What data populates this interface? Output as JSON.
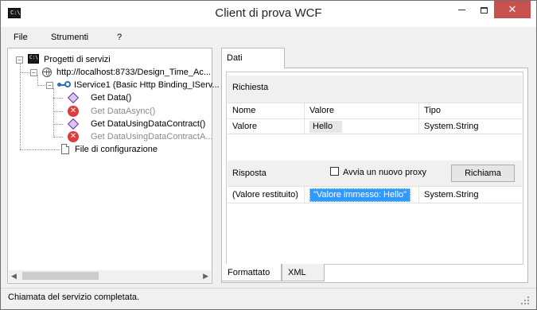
{
  "window": {
    "title": "Client di prova WCF",
    "app_icon": "console-icon",
    "min_glyph": "",
    "max_glyph": "",
    "close_glyph": "✕"
  },
  "menu": {
    "items": [
      "File",
      "Strumenti",
      "?"
    ]
  },
  "tree": {
    "root": "Progetti di servizi",
    "endpoint": "http://localhost:8733/Design_Time_Ac...",
    "contract": "IService1 (Basic Http Binding_IServ...",
    "ops": [
      {
        "label": "Get Data()",
        "state": "ok"
      },
      {
        "label": "Get DataAsync()",
        "state": "error"
      },
      {
        "label": "Get DataUsingDataContract()",
        "state": "ok"
      },
      {
        "label": "Get DataUsingDataContractA...",
        "state": "error"
      }
    ],
    "config": "File di configurazione",
    "expanded_glyph": "−"
  },
  "tabs": {
    "top": "Dati",
    "bottom": [
      "Formattato",
      "XML"
    ]
  },
  "request": {
    "title": "Richiesta",
    "columns": [
      "Nome",
      "Valore",
      "Tipo"
    ],
    "rows": [
      {
        "name": "Valore",
        "value": "Hello",
        "type": "System.String"
      }
    ]
  },
  "response": {
    "title": "Risposta",
    "new_proxy_label": "Avvia un nuovo proxy",
    "new_proxy_checked": false,
    "invoke_button": "Richiama",
    "rows": [
      {
        "name": "(Valore restituito)",
        "value": "\"Valore immesso: Hello\"",
        "type": "System.String"
      }
    ]
  },
  "status": {
    "text": "Chiamata del servizio completata."
  }
}
